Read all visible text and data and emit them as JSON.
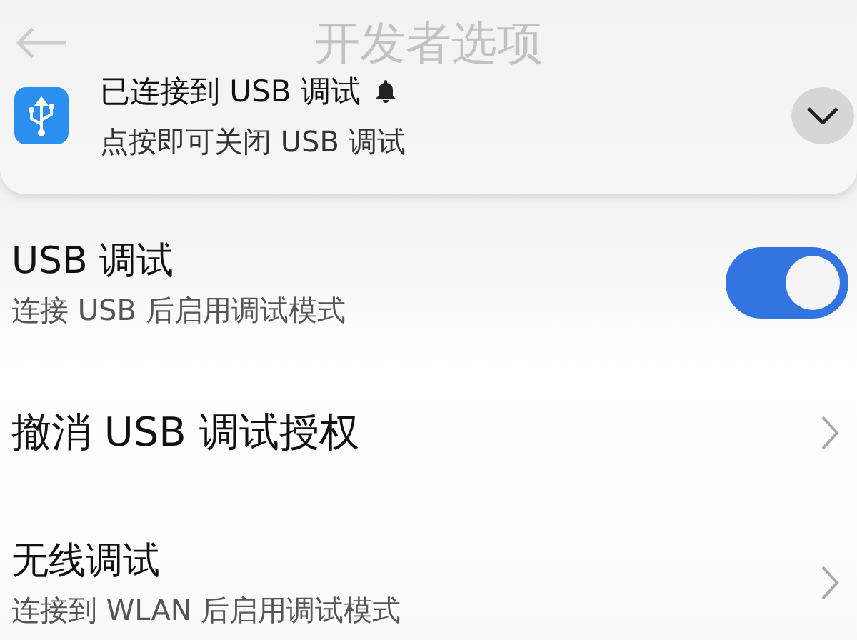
{
  "header": {
    "title": "开发者选项"
  },
  "notification": {
    "title": "已连接到 USB 调试",
    "text": "点按即可关闭 USB 调试",
    "expanded": false
  },
  "settings": [
    {
      "kind": "toggle",
      "title": "USB 调试",
      "subtitle": "连接 USB 后启用调试模式",
      "on": true
    },
    {
      "kind": "link",
      "title": "撤消 USB 调试授权"
    },
    {
      "kind": "link",
      "title": "无线调试",
      "subtitle": "连接到 WLAN 后启用调试模式"
    }
  ]
}
